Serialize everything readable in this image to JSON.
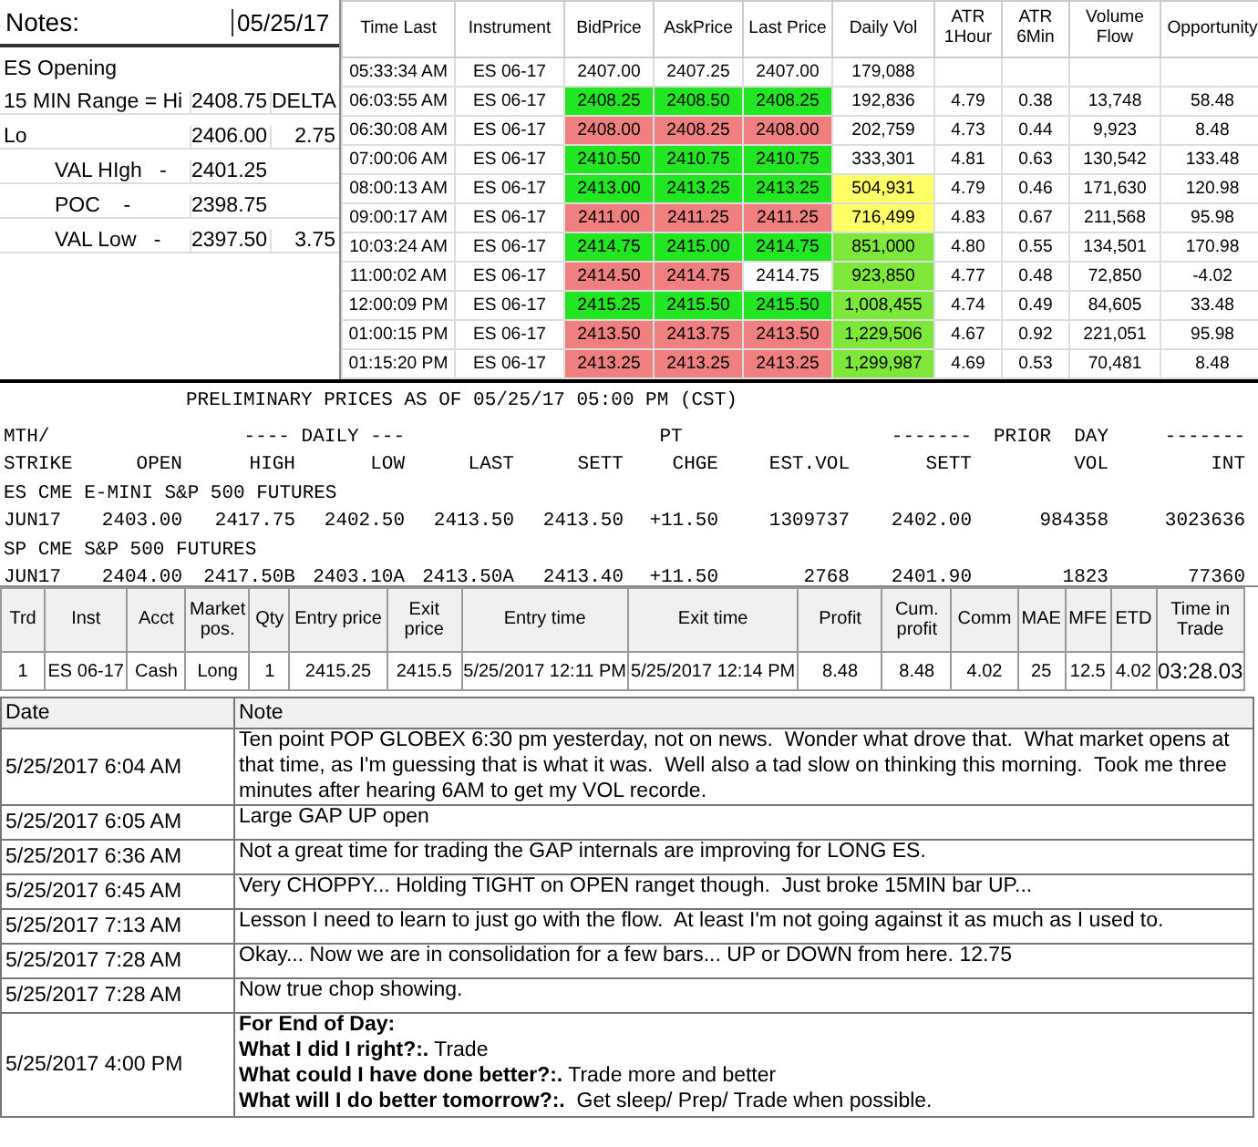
{
  "notes_panel": {
    "title": "Notes:",
    "date": "05/25/17",
    "rows": [
      {
        "label": "ES Opening",
        "value": "",
        "extra": ""
      },
      {
        "label": "15 MIN Range = Hi",
        "value": "2408.75",
        "extra": "DELTA"
      },
      {
        "label": "Lo",
        "value": "2406.00",
        "extra": "2.75"
      },
      {
        "label": "VAL HIgh   -",
        "value": "2401.25",
        "extra": "",
        "indent": true
      },
      {
        "label": "POC    -",
        "value": "2398.75",
        "extra": "",
        "indent": true
      },
      {
        "label": "VAL Low   -",
        "value": "2397.50",
        "extra": "3.75",
        "indent": true
      }
    ]
  },
  "quotes": {
    "columns": [
      "Time Last",
      "Instrument",
      "BidPrice",
      "AskPrice",
      "Last Price",
      "Daily Vol",
      "ATR 1Hour",
      "ATR 6Min",
      "Volume Flow",
      "Opportunity"
    ],
    "rows": [
      {
        "time": "05:33:34 AM",
        "instrument": "ES 06-17",
        "bid": {
          "value": "2407.00",
          "color": "#ffffff"
        },
        "ask": {
          "value": "2407.25",
          "color": "#ffffff"
        },
        "last": {
          "value": "2407.00",
          "color": "#ffffff"
        },
        "daily_vol": {
          "value": "179,088",
          "color": "#ffffff"
        },
        "atr_1hour": "",
        "atr_6min": "",
        "volume_flow": "",
        "opportunity": ""
      },
      {
        "time": "06:03:55 AM",
        "instrument": "ES 06-17",
        "bid": {
          "value": "2408.25",
          "color": "#22e622"
        },
        "ask": {
          "value": "2408.50",
          "color": "#22e622"
        },
        "last": {
          "value": "2408.25",
          "color": "#22e622"
        },
        "daily_vol": {
          "value": "192,836",
          "color": "#ffffff"
        },
        "atr_1hour": "4.79",
        "atr_6min": "0.38",
        "volume_flow": "13,748",
        "opportunity": "58.48"
      },
      {
        "time": "06:30:08 AM",
        "instrument": "ES 06-17",
        "bid": {
          "value": "2408.00",
          "color": "#f08080"
        },
        "ask": {
          "value": "2408.25",
          "color": "#f08080"
        },
        "last": {
          "value": "2408.00",
          "color": "#f08080"
        },
        "daily_vol": {
          "value": "202,759",
          "color": "#ffffff"
        },
        "atr_1hour": "4.73",
        "atr_6min": "0.44",
        "volume_flow": "9,923",
        "opportunity": "8.48"
      },
      {
        "time": "07:00:06 AM",
        "instrument": "ES 06-17",
        "bid": {
          "value": "2410.50",
          "color": "#22e622"
        },
        "ask": {
          "value": "2410.75",
          "color": "#22e622"
        },
        "last": {
          "value": "2410.75",
          "color": "#22e622"
        },
        "daily_vol": {
          "value": "333,301",
          "color": "#ffffff"
        },
        "atr_1hour": "4.81",
        "atr_6min": "0.63",
        "volume_flow": "130,542",
        "opportunity": "133.48"
      },
      {
        "time": "08:00:13 AM",
        "instrument": "ES 06-17",
        "bid": {
          "value": "2413.00",
          "color": "#22e622"
        },
        "ask": {
          "value": "2413.25",
          "color": "#22e622"
        },
        "last": {
          "value": "2413.25",
          "color": "#22e622"
        },
        "daily_vol": {
          "value": "504,931",
          "color": "#ffff66"
        },
        "atr_1hour": "4.79",
        "atr_6min": "0.46",
        "volume_flow": "171,630",
        "opportunity": "120.98"
      },
      {
        "time": "09:00:17 AM",
        "instrument": "ES 06-17",
        "bid": {
          "value": "2411.00",
          "color": "#f08080"
        },
        "ask": {
          "value": "2411.25",
          "color": "#f08080"
        },
        "last": {
          "value": "2411.25",
          "color": "#f08080"
        },
        "daily_vol": {
          "value": "716,499",
          "color": "#ffff66"
        },
        "atr_1hour": "4.83",
        "atr_6min": "0.67",
        "volume_flow": "211,568",
        "opportunity": "95.98"
      },
      {
        "time": "10:03:24 AM",
        "instrument": "ES 06-17",
        "bid": {
          "value": "2414.75",
          "color": "#22e622"
        },
        "ask": {
          "value": "2415.00",
          "color": "#22e622"
        },
        "last": {
          "value": "2414.75",
          "color": "#22e622"
        },
        "daily_vol": {
          "value": "851,000",
          "color": "#7ee83a"
        },
        "atr_1hour": "4.80",
        "atr_6min": "0.55",
        "volume_flow": "134,501",
        "opportunity": "170.98"
      },
      {
        "time": "11:00:02 AM",
        "instrument": "ES 06-17",
        "bid": {
          "value": "2414.50",
          "color": "#f08080"
        },
        "ask": {
          "value": "2414.75",
          "color": "#f08080"
        },
        "last": {
          "value": "2414.75",
          "color": "#ffffff"
        },
        "daily_vol": {
          "value": "923,850",
          "color": "#7ee83a"
        },
        "atr_1hour": "4.77",
        "atr_6min": "0.48",
        "volume_flow": "72,850",
        "opportunity": "-4.02"
      },
      {
        "time": "12:00:09 PM",
        "instrument": "ES 06-17",
        "bid": {
          "value": "2415.25",
          "color": "#22e622"
        },
        "ask": {
          "value": "2415.50",
          "color": "#22e622"
        },
        "last": {
          "value": "2415.50",
          "color": "#22e622"
        },
        "daily_vol": {
          "value": "1,008,455",
          "color": "#7ee83a"
        },
        "atr_1hour": "4.74",
        "atr_6min": "0.49",
        "volume_flow": "84,605",
        "opportunity": "33.48"
      },
      {
        "time": "01:00:15 PM",
        "instrument": "ES 06-17",
        "bid": {
          "value": "2413.50",
          "color": "#f08080"
        },
        "ask": {
          "value": "2413.75",
          "color": "#f08080"
        },
        "last": {
          "value": "2413.50",
          "color": "#f08080"
        },
        "daily_vol": {
          "value": "1,229,506",
          "color": "#7ee83a"
        },
        "atr_1hour": "4.67",
        "atr_6min": "0.92",
        "volume_flow": "221,051",
        "opportunity": "95.98"
      },
      {
        "time": "01:15:20 PM",
        "instrument": "ES 06-17",
        "bid": {
          "value": "2413.25",
          "color": "#f08080"
        },
        "ask": {
          "value": "2413.25",
          "color": "#f08080"
        },
        "last": {
          "value": "2413.25",
          "color": "#f08080"
        },
        "daily_vol": {
          "value": "1,299,987",
          "color": "#7ee83a"
        },
        "atr_1hour": "4.69",
        "atr_6min": "0.53",
        "volume_flow": "70,481",
        "opportunity": "8.48"
      }
    ]
  },
  "settlement": {
    "title": "PRELIMINARY PRICES AS OF 05/25/17 05:00 PM (CST)",
    "group_headers": [
      "MTH/",
      "---- DAILY ---",
      "PT",
      "-------",
      "PRIOR  DAY",
      "-------"
    ],
    "columns": [
      "STRIKE",
      "OPEN",
      "HIGH",
      "LOW",
      "LAST",
      "SETT",
      "CHGE",
      "EST.VOL",
      "SETT",
      "VOL",
      "INT"
    ],
    "sections": [
      {
        "name": "ES CME E-MINI S&P 500 FUTURES",
        "rows": [
          [
            "JUN17",
            "2403.00",
            "2417.75",
            "2402.50",
            "2413.50",
            "2413.50",
            "+11.50",
            "1309737",
            "2402.00",
            "984358",
            "3023636"
          ]
        ]
      },
      {
        "name": "SP CME S&P 500 FUTURES",
        "rows": [
          [
            "JUN17",
            "2404.00",
            "2417.50B",
            "2403.10A",
            "2413.50A",
            "2413.40",
            "+11.50",
            "2768",
            "2401.90",
            "1823",
            "77360"
          ]
        ]
      }
    ]
  },
  "trades": {
    "columns": [
      "Trd",
      "Inst",
      "Acct",
      "Market pos.",
      "Qty",
      "Entry price",
      "Exit price",
      "Entry time",
      "Exit time",
      "Profit",
      "Cum. profit",
      "Comm",
      "MAE",
      "MFE",
      "ETD",
      "Time in Trade"
    ],
    "rows": [
      [
        "1",
        "ES 06-17",
        "Cash",
        "Long",
        "1",
        "2415.25",
        "2415.5",
        "5/25/2017 12:11 PM",
        "5/25/2017 12:14 PM",
        "8.48",
        "8.48",
        "4.02",
        "25",
        "12.5",
        "4.02",
        "03:28.03"
      ]
    ]
  },
  "journal": {
    "columns": [
      "Date",
      "Note"
    ],
    "rows": [
      {
        "date": "5/25/2017 6:04 AM",
        "lines": [
          "Ten point POP GLOBEX 6:30 pm yesterday, not on news.  Wonder what drove that.  What market opens at that time, as I'm guessing that is what it was.  Well also a tad slow on thinking this morning.  Took me three minutes after hearing 6AM to get my VOL recorde."
        ]
      },
      {
        "date": "5/25/2017 6:05 AM",
        "lines": [
          "Large GAP UP open"
        ]
      },
      {
        "date": "5/25/2017 6:36 AM",
        "lines": [
          "Not a great time for trading the GAP internals are improving for LONG ES."
        ]
      },
      {
        "date": "5/25/2017 6:45 AM",
        "lines": [
          "Very CHOPPY... Holding TIGHT on OPEN ranget though.  Just broke 15MIN bar UP..."
        ]
      },
      {
        "date": "5/25/2017 7:13 AM",
        "lines": [
          "Lesson I need to learn to just go with the flow.  At least I'm not going against it as much as I used to."
        ]
      },
      {
        "date": "5/25/2017 7:28 AM",
        "lines": [
          "Okay... Now we are in consolidation for a few bars... UP or DOWN from here. 12.75"
        ]
      },
      {
        "date": "5/25/2017 7:28 AM",
        "lines": [
          "Now true chop showing."
        ]
      },
      {
        "date": "5/25/2017 4:00 PM",
        "lines": [
          "**For End of Day:**",
          "**What I did I right?:.** Trade",
          "**What could I have done better?:.** Trade more and better",
          "**What will I do better tomorrow?:.**  Get sleep/ Prep/ Trade when possible."
        ]
      }
    ]
  }
}
